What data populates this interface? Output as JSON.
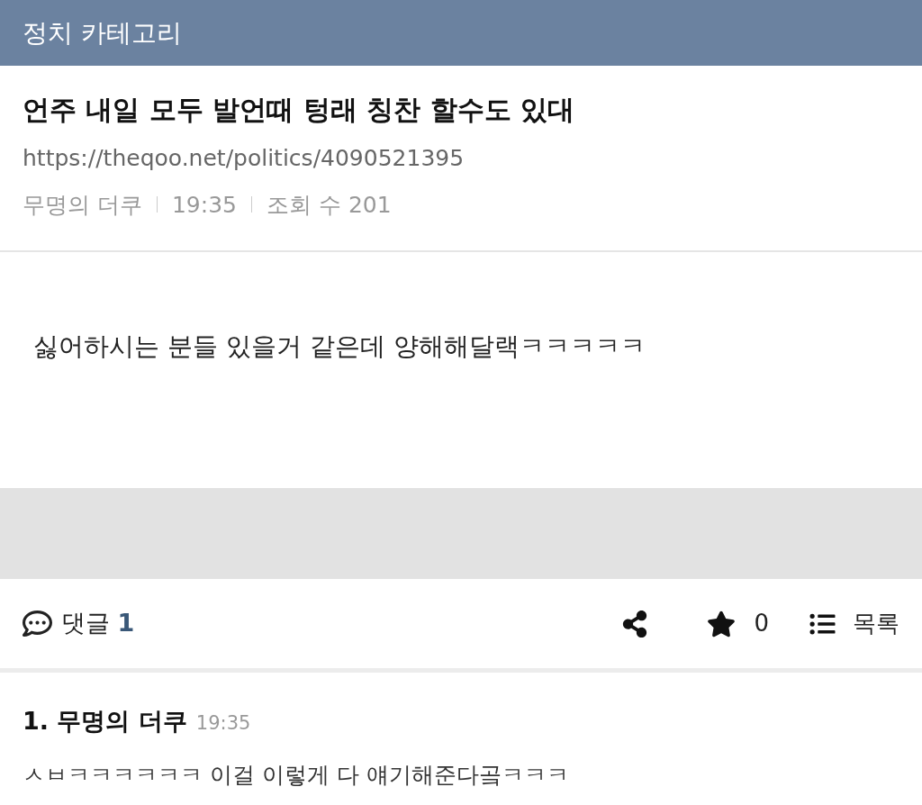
{
  "header": {
    "title": "정치 카테고리"
  },
  "post": {
    "title": "언주 내일 모두 발언때 텅래 칭찬 할수도 있대",
    "url": "https://theqoo.net/politics/4090521395",
    "author": "무명의 더쿠",
    "time": "19:35",
    "views": "조회 수 201",
    "body": "싫어하시는 분들 있을거 같은데 양해해달랙ㅋㅋㅋㅋㅋ"
  },
  "actions": {
    "comments_label": "댓글",
    "comments_count": "1",
    "stars_count": "0",
    "list_label": "목록"
  },
  "comments": [
    {
      "number": "1.",
      "author": "무명의 더쿠",
      "time": "19:35",
      "text": "ㅅㅂㅋㅋㅋㅋㅋㅋ 이걸 이렇게 다 얘기해준다곸ㅋㅋㅋ"
    }
  ]
}
